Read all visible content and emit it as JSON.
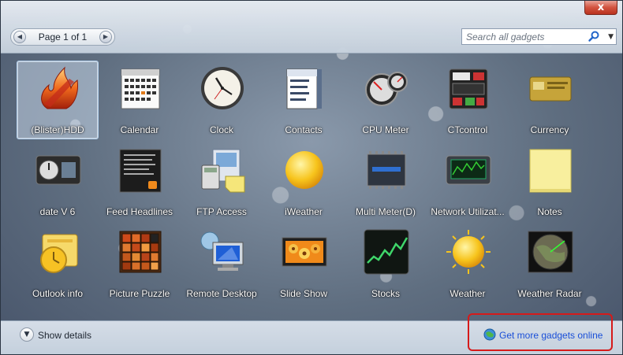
{
  "window": {
    "close_label": "x"
  },
  "pager": {
    "label": "Page 1 of 1",
    "prev_icon": "chevron-left-icon",
    "next_icon": "chevron-right-icon"
  },
  "search": {
    "placeholder": "Search all gadgets",
    "value": ""
  },
  "gadgets": [
    {
      "name": "(Blister)HDD",
      "icon": "blister-hdd-icon",
      "selected": true
    },
    {
      "name": "Calendar",
      "icon": "calendar-icon"
    },
    {
      "name": "Clock",
      "icon": "clock-icon"
    },
    {
      "name": "Contacts",
      "icon": "contacts-icon"
    },
    {
      "name": "CPU Meter",
      "icon": "cpu-meter-icon"
    },
    {
      "name": "CTcontrol",
      "icon": "ctcontrol-icon"
    },
    {
      "name": "Currency",
      "icon": "currency-icon"
    },
    {
      "name": "date V 6",
      "icon": "date-v6-icon"
    },
    {
      "name": "Feed Headlines",
      "icon": "feed-headlines-icon"
    },
    {
      "name": "FTP Access",
      "icon": "ftp-access-icon"
    },
    {
      "name": "iWeather",
      "icon": "iweather-icon"
    },
    {
      "name": "Multi Meter(D)",
      "icon": "multi-meter-icon"
    },
    {
      "name": "Network Utilizat...",
      "icon": "network-utilization-icon"
    },
    {
      "name": "Notes",
      "icon": "notes-icon"
    },
    {
      "name": "Outlook info",
      "icon": "outlook-info-icon"
    },
    {
      "name": "Picture Puzzle",
      "icon": "picture-puzzle-icon"
    },
    {
      "name": "Remote Desktop",
      "icon": "remote-desktop-icon"
    },
    {
      "name": "Slide Show",
      "icon": "slide-show-icon"
    },
    {
      "name": "Stocks",
      "icon": "stocks-icon"
    },
    {
      "name": "Weather",
      "icon": "weather-icon"
    },
    {
      "name": "Weather Radar",
      "icon": "weather-radar-icon"
    }
  ],
  "footer": {
    "show_details_label": "Show details",
    "get_more_label": "Get more gadgets online"
  },
  "colors": {
    "link": "#1a4fd8",
    "highlight_box": "#d61a1a",
    "selection": "#b6d4f2"
  }
}
